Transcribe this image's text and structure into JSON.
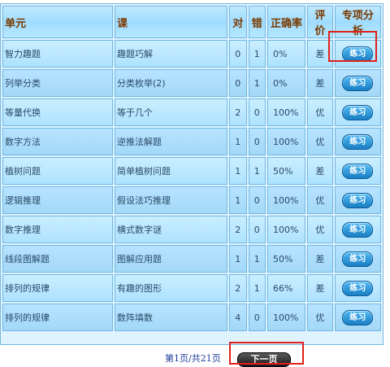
{
  "headers": {
    "unit": "单元",
    "lesson": "课",
    "correct": "对",
    "wrong": "错",
    "accuracy": "正确率",
    "rating": "评价",
    "analysis": "专项分析"
  },
  "rows": [
    {
      "unit": "智力趣题",
      "lesson": "趣题巧解",
      "correct": "0",
      "wrong": "1",
      "accuracy": "0%",
      "rating": "差",
      "action": "练习"
    },
    {
      "unit": "列举分类",
      "lesson": "分类枚举(2)",
      "correct": "0",
      "wrong": "1",
      "accuracy": "0%",
      "rating": "差",
      "action": "练习"
    },
    {
      "unit": "等量代换",
      "lesson": "等于几个",
      "correct": "2",
      "wrong": "0",
      "accuracy": "100%",
      "rating": "优",
      "action": "练习"
    },
    {
      "unit": "数字方法",
      "lesson": "逆推法解题",
      "correct": "1",
      "wrong": "0",
      "accuracy": "100%",
      "rating": "优",
      "action": "练习"
    },
    {
      "unit": "植树问题",
      "lesson": "简单植树问题",
      "correct": "1",
      "wrong": "1",
      "accuracy": "50%",
      "rating": "差",
      "action": "练习"
    },
    {
      "unit": "逻辑推理",
      "lesson": "假设法巧推理",
      "correct": "1",
      "wrong": "0",
      "accuracy": "100%",
      "rating": "优",
      "action": "练习"
    },
    {
      "unit": "数字推理",
      "lesson": "横式数字谜",
      "correct": "2",
      "wrong": "0",
      "accuracy": "100%",
      "rating": "优",
      "action": "练习"
    },
    {
      "unit": "线段图解题",
      "lesson": "图解应用题",
      "correct": "1",
      "wrong": "1",
      "accuracy": "50%",
      "rating": "差",
      "action": "练习"
    },
    {
      "unit": "排列的规律",
      "lesson": "有趣的图形",
      "correct": "2",
      "wrong": "1",
      "accuracy": "66%",
      "rating": "差",
      "action": "练习"
    },
    {
      "unit": "排列的规律",
      "lesson": "数阵填数",
      "correct": "4",
      "wrong": "0",
      "accuracy": "100%",
      "rating": "优",
      "action": "练习"
    }
  ],
  "pager": {
    "text": "第1页/共21页",
    "next_label": "下一页"
  },
  "colors": {
    "highlight": "#e0201a",
    "header_text": "#7a3a00",
    "cell_bg": "#aee2ff"
  }
}
